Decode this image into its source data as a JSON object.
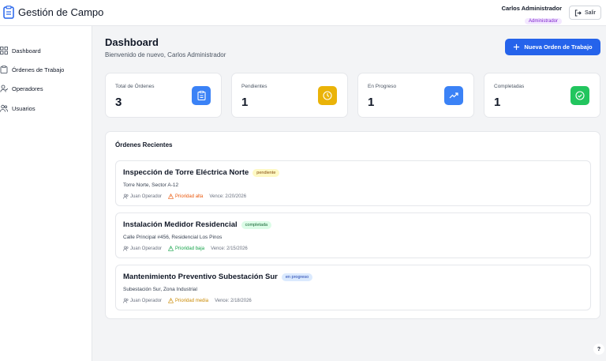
{
  "app": {
    "title": "Gestión de Campo"
  },
  "header": {
    "user_name": "Carlos Administrador",
    "role": "Administrador",
    "logout_label": "Salir"
  },
  "sidebar": {
    "items": [
      {
        "label": "Dashboard",
        "icon": "grid-icon"
      },
      {
        "label": "Órdenes de Trabajo",
        "icon": "clipboard-icon"
      },
      {
        "label": "Operadores",
        "icon": "user-icon"
      },
      {
        "label": "Usuarios",
        "icon": "users-icon"
      }
    ]
  },
  "page": {
    "title": "Dashboard",
    "subtitle": "Bienvenido de nuevo, Carlos Administrador",
    "new_order_label": "Nueva Orden de Trabajo"
  },
  "stats": [
    {
      "label": "Total de Órdenes",
      "value": "3",
      "icon": "clipboard-icon",
      "color": "#3b82f6"
    },
    {
      "label": "Pendientes",
      "value": "1",
      "icon": "clock-icon",
      "color": "#eab308"
    },
    {
      "label": "En Progreso",
      "value": "1",
      "icon": "trending-up-icon",
      "color": "#3b82f6"
    },
    {
      "label": "Completadas",
      "value": "1",
      "icon": "check-circle-icon",
      "color": "#22c55e"
    }
  ],
  "recent": {
    "title": "Órdenes Recientes",
    "orders": [
      {
        "title": "Inspección de Torre Eléctrica Norte",
        "status": "pendiente",
        "status_bg": "#fef9c3",
        "status_fg": "#854d0e",
        "location": "Torre Norte, Sector A-12",
        "operator": "Juan Operador",
        "priority": "Prioridad alta",
        "priority_color": "#ea580c",
        "due": "Vence: 2/20/2026"
      },
      {
        "title": "Instalación Medidor Residencial",
        "status": "completada",
        "status_bg": "#dcfce7",
        "status_fg": "#166534",
        "location": "Calle Principal #456, Residencial Los Pinos",
        "operator": "Juan Operador",
        "priority": "Prioridad baja",
        "priority_color": "#16a34a",
        "due": "Vence: 2/15/2026"
      },
      {
        "title": "Mantenimiento Preventivo Subestación Sur",
        "status": "en progreso",
        "status_bg": "#dbeafe",
        "status_fg": "#1e40af",
        "location": "Subestación Sur, Zona Industrial",
        "operator": "Juan Operador",
        "priority": "Prioridad media",
        "priority_color": "#ca8a04",
        "due": "Vence: 2/18/2026"
      }
    ]
  },
  "help": {
    "label": "?"
  }
}
